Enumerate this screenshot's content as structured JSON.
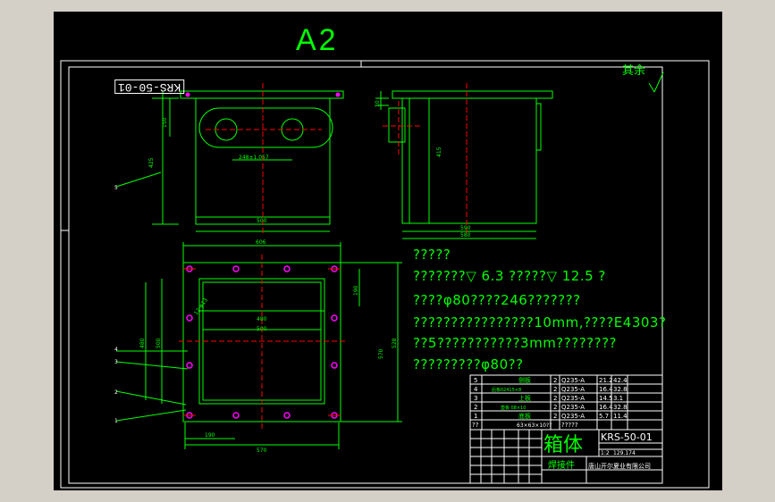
{
  "sheet": {
    "size_label": "A2",
    "drawing_code_rotated": "KRS-50-01",
    "other_label": "其余",
    "colors": {
      "background": "#000000",
      "frame": "#ffffff",
      "outline": "#00ff00",
      "centerline": "#ff0000",
      "hole": "#ff00ff"
    }
  },
  "dimensions": {
    "front_width": "500",
    "front_height": "425",
    "front_top_offset": "150",
    "front_circle_spacing": "248±1.057",
    "side_depth": "590",
    "side_depth_inner": "580",
    "side_height": "415",
    "side_top": "10",
    "plan_overall": "606",
    "plan_480_h": "480",
    "plan_500_h": "500",
    "plan_480_v": "480",
    "plan_500_v": "500",
    "plan_right": "528",
    "plan_190_right": "190",
    "plan_570_v": "570",
    "plan_190_bottom": "190",
    "plan_570_bottom": "570",
    "plan_holes": "12-φ13"
  },
  "notes": [
    "?????",
    "???????▽ 6.3  ?????▽ 12.5    ?",
    "????φ80????246???????",
    "????????????????10mm,????E4303?",
    "??5???????????3mm????????",
    "?????????φ80??"
  ],
  "callouts": [
    "1",
    "2",
    "3",
    "4",
    "5"
  ],
  "bom": [
    {
      "no": "5",
      "name": "侧板",
      "qty": "2",
      "material": "Q235-A",
      "w1": "21.2",
      "w2": "42.4"
    },
    {
      "no": "4",
      "name": "后板δ2415×8",
      "qty": "2",
      "material": "Q235-A",
      "w1": "16.4",
      "w2": "32.8"
    },
    {
      "no": "3",
      "name": "上板",
      "qty": "2",
      "material": "Q235-A",
      "w1": "14.5",
      "w2": "3.1"
    },
    {
      "no": "2",
      "name": "垫板 δ8×10",
      "qty": "2",
      "material": "Q235-A",
      "w1": "16.4",
      "w2": "32.8"
    },
    {
      "no": "1",
      "name": "底板",
      "qty": "2",
      "material": "Q235-A",
      "w1": "5.7",
      "w2": "11.4"
    },
    {
      "no": "??",
      "name": "63×63×10??",
      "qty": "",
      "material": "?????",
      "w1": "",
      "w2": ""
    }
  ],
  "title_block": {
    "part_name": "箱体",
    "drawing_no": "KRS-50-01",
    "type_label": "焊接件",
    "scale": "1:2",
    "weight": "129.174",
    "company": "唐山开尔夏业有限公司"
  }
}
